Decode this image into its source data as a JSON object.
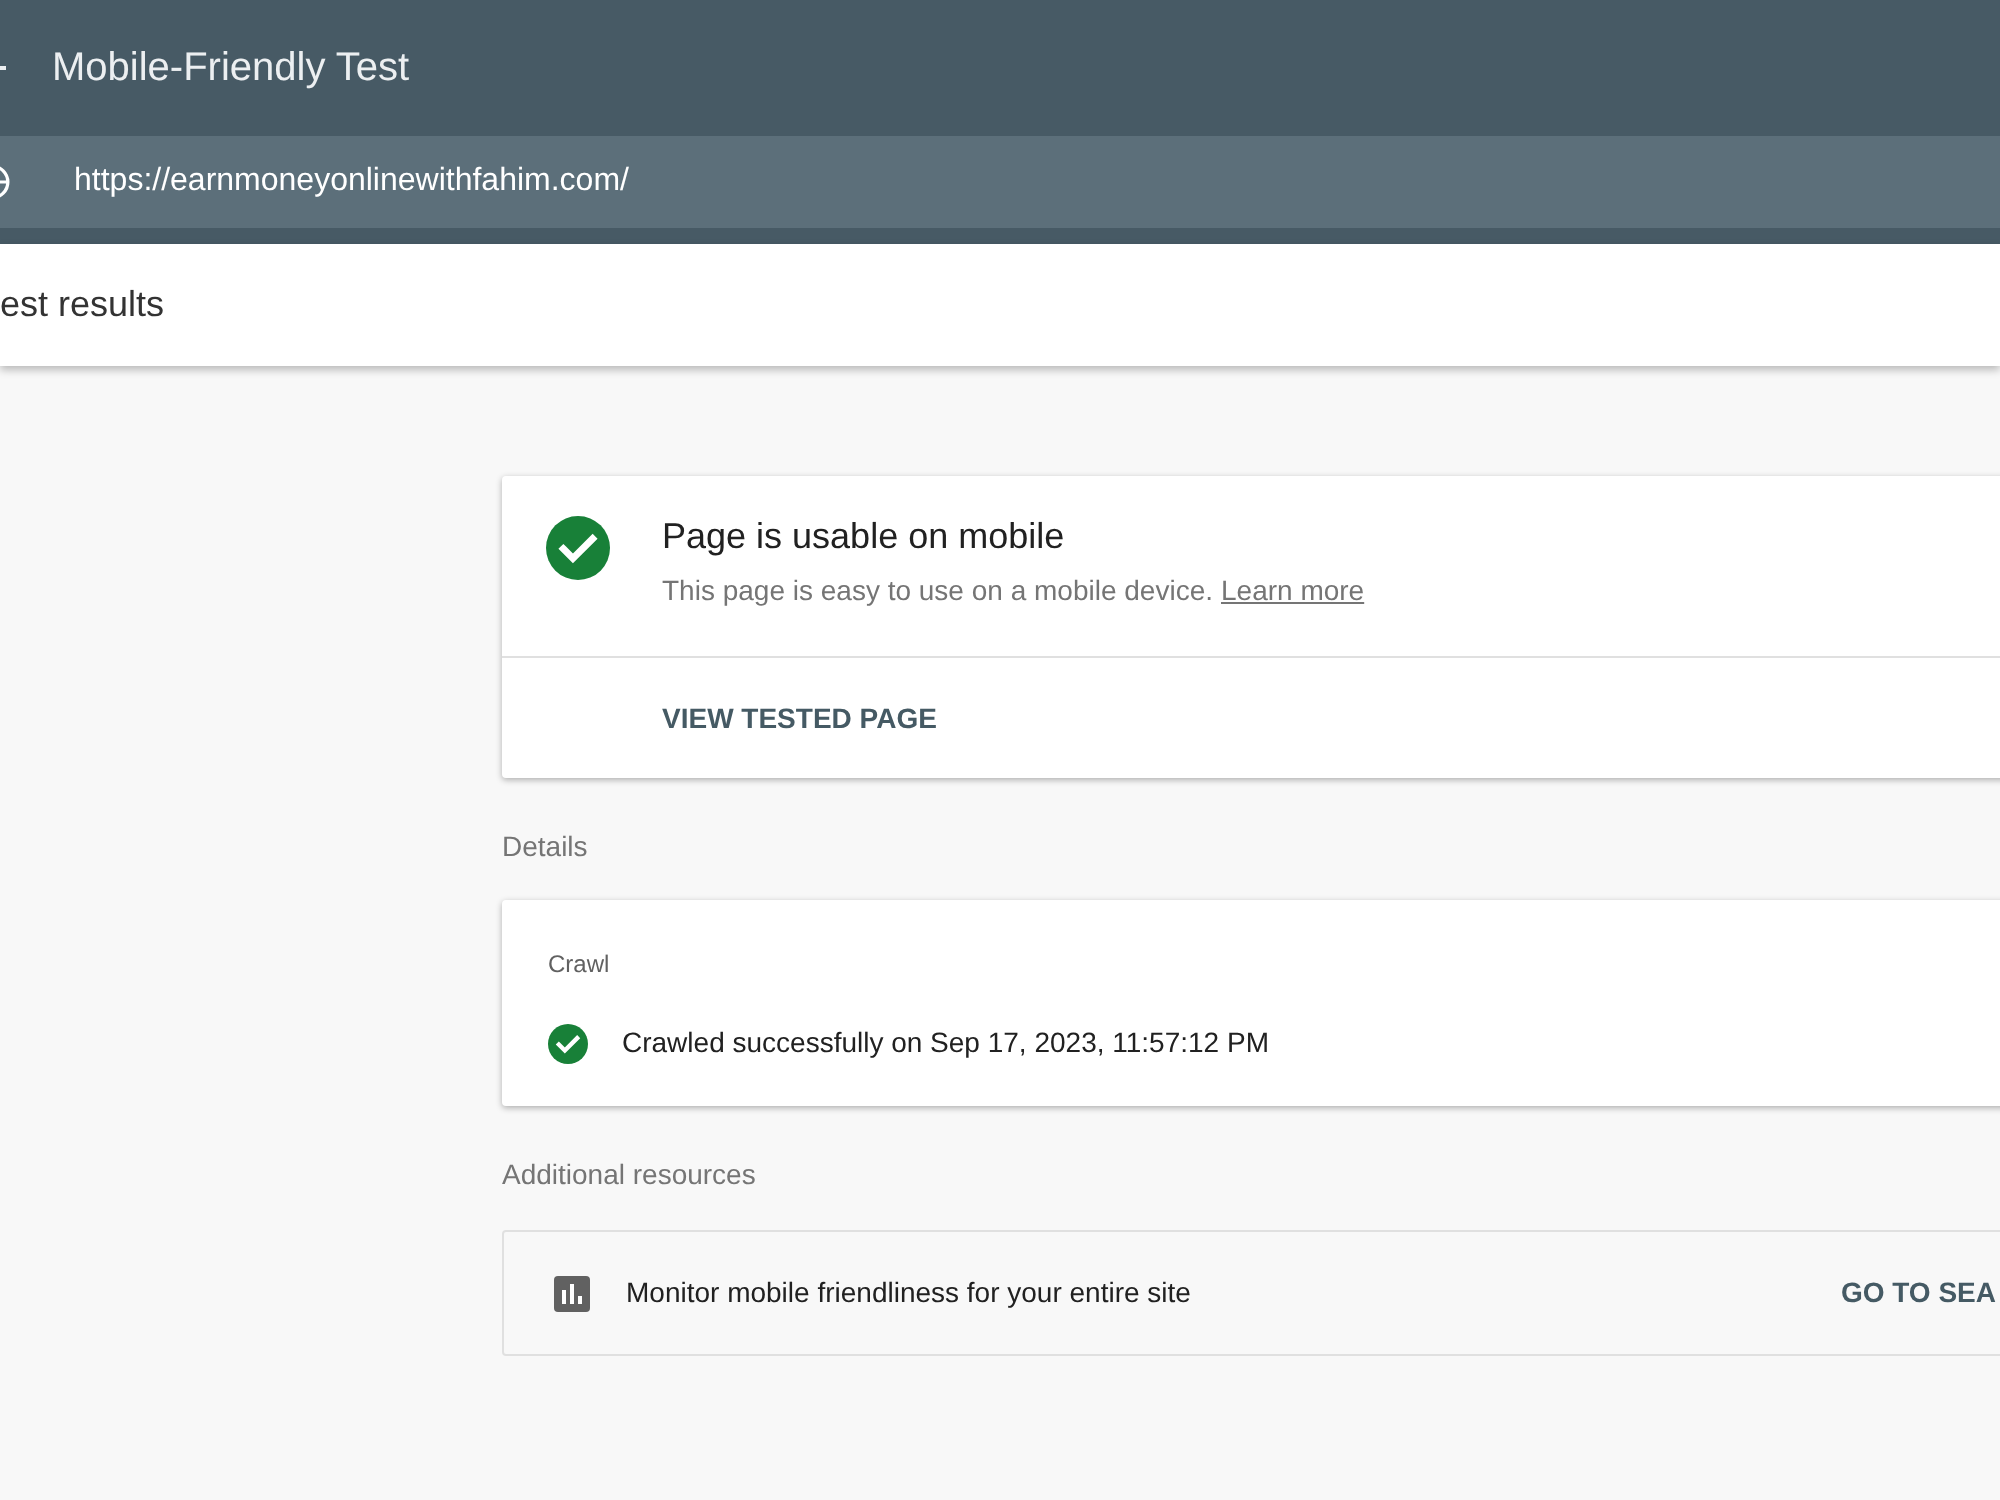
{
  "header": {
    "title": "Mobile-Friendly Test"
  },
  "url_bar": {
    "url": "https://earnmoneyonlinewithfahim.com/"
  },
  "results_bar": {
    "title": "est results"
  },
  "verdict": {
    "passed": true,
    "title": "Page is usable on mobile",
    "description": "This page is easy to use on a mobile device.",
    "link": "Learn more",
    "action": "VIEW TESTED PAGE"
  },
  "details": {
    "heading": "Details",
    "sections": [
      {
        "title": "Crawl",
        "items": [
          {
            "passed": true,
            "text": "Crawled successfully on Sep 17, 2023, 11:57:12 PM"
          }
        ]
      }
    ]
  },
  "resources": {
    "heading": "Additional resources",
    "items": [
      {
        "text": "Monitor mobile friendliness for your entire site",
        "action": "GO TO SEA"
      }
    ]
  }
}
